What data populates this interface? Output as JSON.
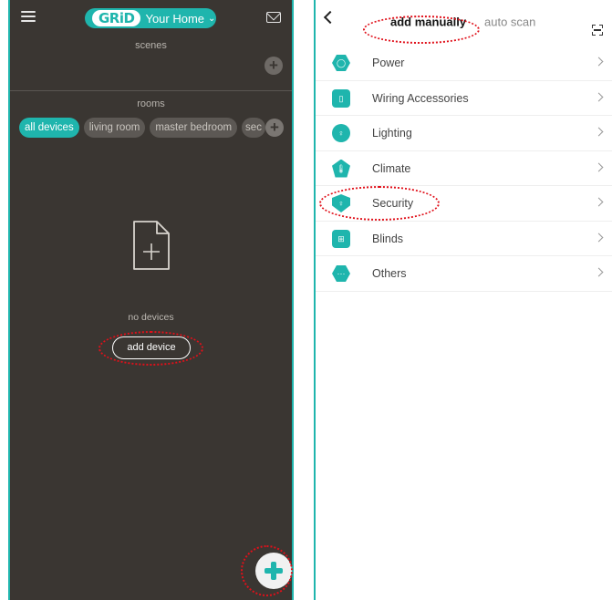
{
  "left": {
    "topbar": {
      "logo_text": "GRiD",
      "home_name": "Your Home",
      "home_chevron": "⌄"
    },
    "scenes": {
      "label": "scenes",
      "add_symbol": "+"
    },
    "rooms": {
      "label": "rooms",
      "tabs": [
        "all devices",
        "living room",
        "master bedroom",
        "sec"
      ],
      "add_symbol": "+"
    },
    "empty_state": {
      "message": "no devices",
      "button_label": "add device"
    }
  },
  "right": {
    "tabs": {
      "manual": "add manually",
      "auto": "auto scan"
    },
    "categories": [
      {
        "label": "Power",
        "icon": "power-icon",
        "glyph": "◯"
      },
      {
        "label": "Wiring Accessories",
        "icon": "switch-icon",
        "glyph": "▯"
      },
      {
        "label": "Lighting",
        "icon": "bulb-icon",
        "glyph": "♀"
      },
      {
        "label": "Climate",
        "icon": "thermometer-icon",
        "glyph": "🌡"
      },
      {
        "label": "Security",
        "icon": "security-bulb-icon",
        "glyph": "♀"
      },
      {
        "label": "Blinds",
        "icon": "blinds-icon",
        "glyph": "⊞"
      },
      {
        "label": "Others",
        "icon": "more-icon",
        "glyph": "···"
      }
    ]
  },
  "colors": {
    "accent": "#1fb5ad",
    "dark_bg": "#3a3632",
    "highlight": "#e0101a"
  }
}
